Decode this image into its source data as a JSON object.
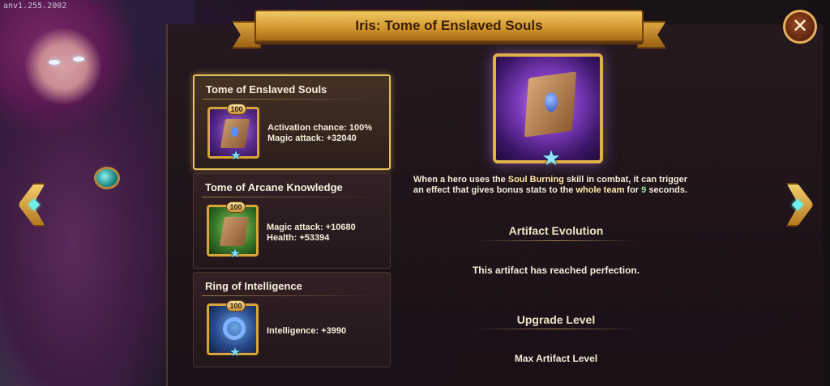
{
  "version": "anv1.255.2002",
  "title": "Iris: Tome of Enslaved Souls",
  "artifacts": [
    {
      "name": "Tome of Enslaved Souls",
      "level": "100",
      "icon": "tome-icon",
      "stats": [
        "Activation chance: 100%",
        "Magic attack: +32040"
      ],
      "selected": true
    },
    {
      "name": "Tome of Arcane Knowledge",
      "level": "100",
      "icon": "arcane-tome-icon",
      "stats": [
        "Magic attack: +10680",
        "Health: +53394"
      ],
      "selected": false
    },
    {
      "name": "Ring of Intelligence",
      "level": "100",
      "icon": "ring-icon",
      "stats": [
        "Intelligence: +3990"
      ],
      "selected": false
    }
  ],
  "detail": {
    "description_part1": "When a hero uses the ",
    "description_skill": "Soul Burning",
    "description_part2": " skill in combat, it can trigger an effect that gives bonus stats to the ",
    "description_team": "whole team",
    "description_part3": " for ",
    "description_seconds": "9",
    "description_part4": " seconds.",
    "evolution_header": "Artifact Evolution",
    "evolution_text": "This artifact has reached perfection.",
    "upgrade_header": "Upgrade Level",
    "upgrade_text": "Max Artifact Level"
  },
  "close_icon": "close-icon",
  "colors": {
    "gold": "#e7c15b",
    "banner": "#d49a2e",
    "highlight_number": "#8fe6a0"
  }
}
